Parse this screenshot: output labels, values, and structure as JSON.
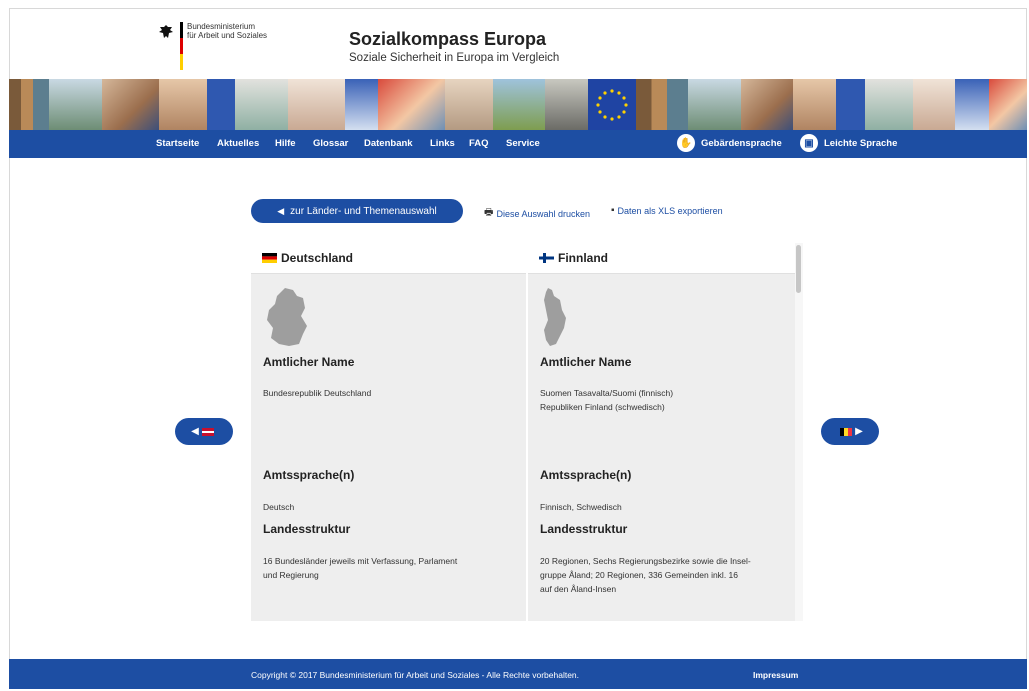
{
  "header": {
    "ministry_line1": "Bundesministerium",
    "ministry_line2": "für Arbeit und Soziales",
    "title": "Sozialkompass Europa",
    "subtitle": "Soziale Sicherheit in Europa im Vergleich"
  },
  "nav": {
    "items": [
      "Startseite",
      "Aktuelles",
      "Hilfe",
      "Glossar",
      "Datenbank",
      "Links",
      "FAQ",
      "Service"
    ],
    "sign_language": "Gebärdensprache",
    "easy_language": "Leichte Sprache"
  },
  "actions": {
    "back_label": "zur Länder- und Themenauswahl",
    "print_label": "Diese Auswahl drucken",
    "export_label": "Daten als XLS exportieren"
  },
  "countries": [
    {
      "name": "Deutschland",
      "official_name_heading": "Amtlicher Name",
      "official_name": [
        "Bundesrepublik Deutschland"
      ],
      "language_heading": "Amtssprache(n)",
      "language": "Deutsch",
      "structure_heading": "Landesstruktur",
      "structure": [
        "16 Bundesländer jeweils mit Verfassung, Parlament",
        "und Regierung"
      ]
    },
    {
      "name": "Finnland",
      "official_name_heading": "Amtlicher Name",
      "official_name": [
        "Suomen Tasavalta/Suomi (finnisch)",
        "Republiken Finland (schwedisch)"
      ],
      "language_heading": "Amtssprache(n)",
      "language": "Finnisch, Schwedisch",
      "structure_heading": "Landesstruktur",
      "structure": [
        "20 Regionen, Sechs Regierungsbezirke sowie die Insel-",
        "gruppe Åland; 20 Regionen, 336 Gemeinden inkl. 16",
        "auf den Åland-Insen"
      ]
    }
  ],
  "footer": {
    "copyright": "Copyright © 2017 Bundesministerium für Arbeit und Soziales - Alle Rechte vorbehalten.",
    "imprint": "Impressum"
  },
  "colors": {
    "brand_blue": "#1d4ea3",
    "panel_grey": "#eeeeee"
  },
  "icons": {
    "prev": "prev-country-arrow-icon",
    "next": "next-country-arrow-icon",
    "print": "printer-icon",
    "export": "xls-export-icon"
  }
}
